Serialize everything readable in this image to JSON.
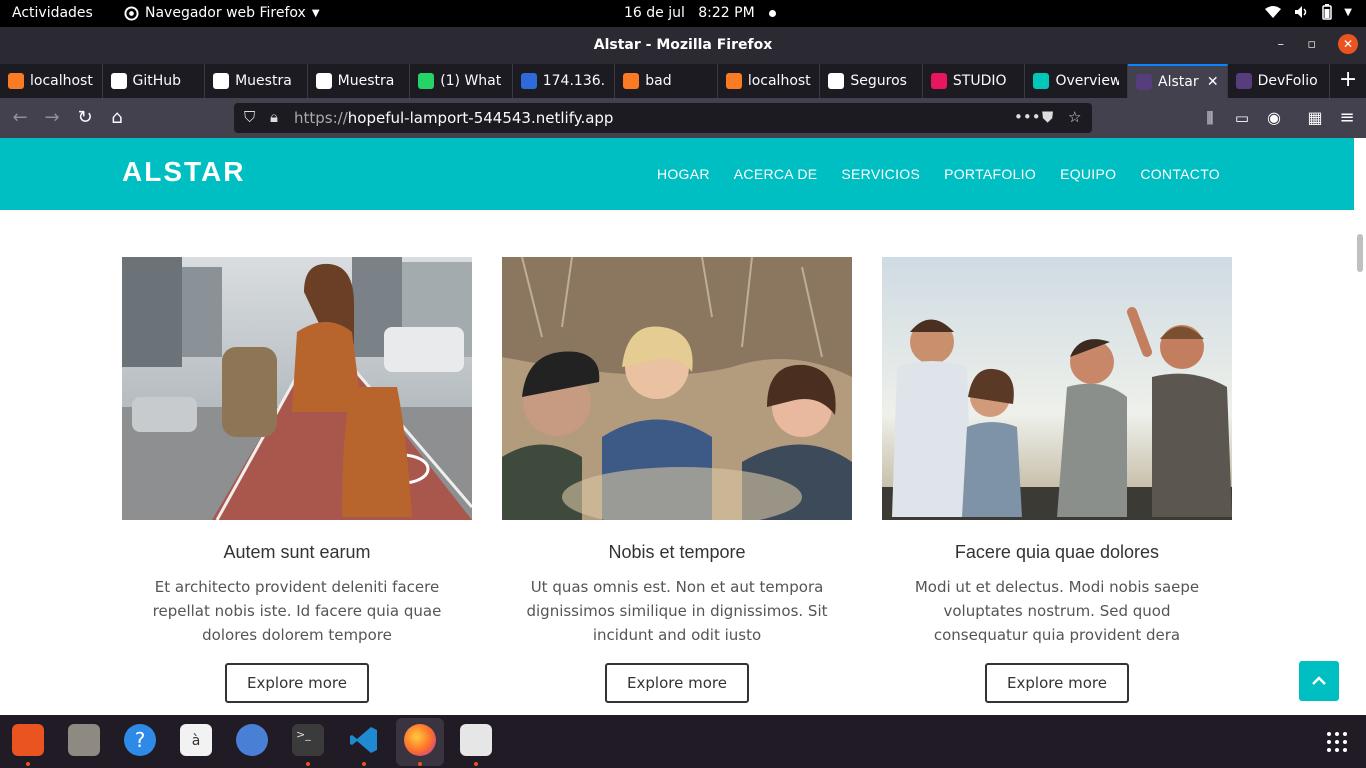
{
  "system_bar": {
    "activities": "Actividades",
    "app_name": "Navegador web Firefox",
    "date": "16 de jul",
    "time": "8:22 PM"
  },
  "window": {
    "title": "Alstar - Mozilla Firefox"
  },
  "tabs": [
    {
      "label": "localhost",
      "icon": "xampp-icon",
      "color": "#fb7a24"
    },
    {
      "label": "GitHub",
      "icon": "github-icon",
      "color": "#ffffff"
    },
    {
      "label": "Muestra",
      "icon": "github-icon",
      "color": "#ffffff"
    },
    {
      "label": "Muestra",
      "icon": "github-icon",
      "color": "#ffffff"
    },
    {
      "label": "(1) What",
      "icon": "whatsapp-icon",
      "color": "#25d366"
    },
    {
      "label": "174.136.",
      "icon": "circle-icon",
      "color": "#2f6bd8"
    },
    {
      "label": "bad",
      "icon": "xampp-icon",
      "color": "#fb7a24"
    },
    {
      "label": "localhost",
      "icon": "xampp-icon",
      "color": "#fb7a24"
    },
    {
      "label": "Seguros",
      "icon": "wordpress-icon",
      "color": "#ffffff"
    },
    {
      "label": "STUDIO",
      "icon": "studio-icon",
      "color": "#e8175d"
    },
    {
      "label": "Overview",
      "icon": "diamond-icon",
      "color": "#00c7b7"
    },
    {
      "label": "Alstar",
      "icon": "bootstrap-icon",
      "color": "#563d7c",
      "active": true
    },
    {
      "label": "DevFolio",
      "icon": "bootstrap-icon",
      "color": "#563d7c"
    }
  ],
  "address_bar": {
    "protocol": "https://",
    "host": "hopeful-lamport-544543.netlify.app"
  },
  "site": {
    "brand": "ALSTAR",
    "menu": [
      "HOGAR",
      "ACERCA DE",
      "SERVICIOS",
      "PORTAFOLIO",
      "EQUIPO",
      "CONTACTO"
    ],
    "cards": [
      {
        "title": "Autem sunt earum",
        "text": "Et architecto provident deleniti facere repellat nobis iste. Id facere quia quae dolores dolorem tempore",
        "button": "Explore more"
      },
      {
        "title": "Nobis et tempore",
        "text": "Ut quas omnis est. Non et aut tempora dignissimos similique in dignissimos. Sit incidunt and odit iusto",
        "button": "Explore more"
      },
      {
        "title": "Facere quia quae dolores",
        "text": "Modi ut et delectus. Modi nobis saepe voluptates nostrum. Sed quod consequatur quia provident dera",
        "button": "Explore more"
      }
    ]
  },
  "dock": [
    "ubuntu-software-icon",
    "files-icon",
    "help-icon",
    "text-editor-icon",
    "chromium-icon",
    "terminal-icon",
    "vscode-icon",
    "firefox-icon",
    "screenshot-icon"
  ]
}
